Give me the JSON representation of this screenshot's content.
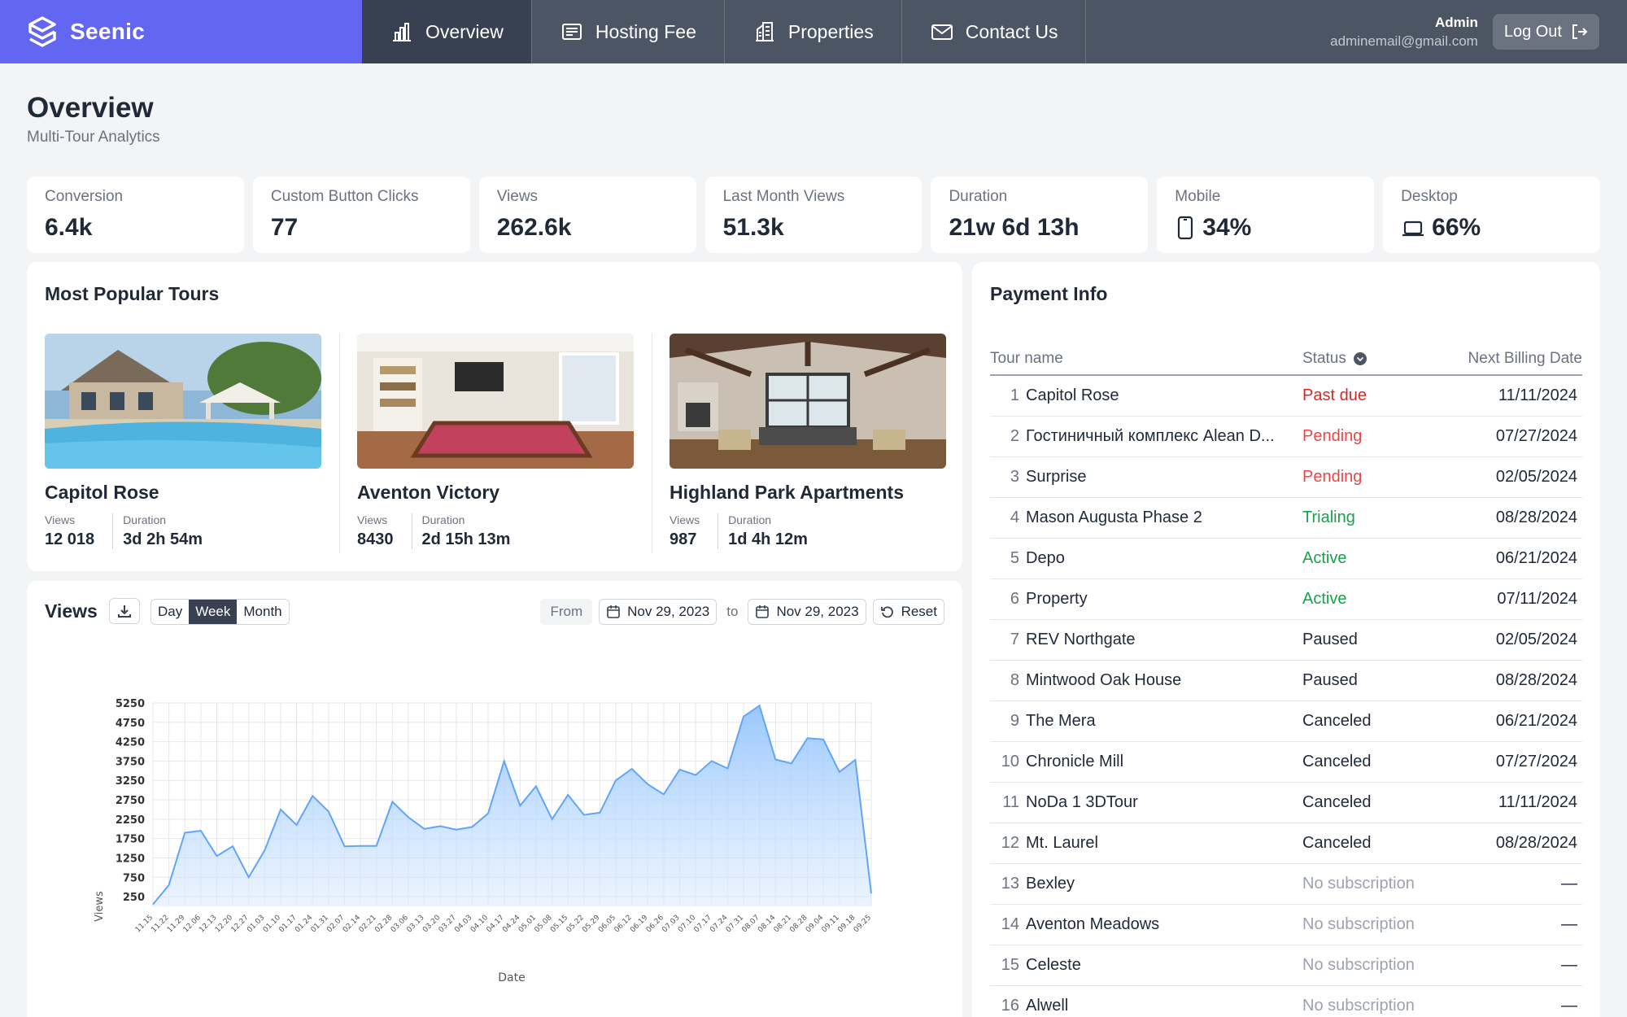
{
  "brand": {
    "name": "Seenic"
  },
  "nav": [
    {
      "label": "Overview",
      "icon": "chart-bar-icon"
    },
    {
      "label": "Hosting Fee",
      "icon": "receipt-icon"
    },
    {
      "label": "Properties",
      "icon": "building-icon"
    },
    {
      "label": "Contact Us",
      "icon": "mail-icon"
    }
  ],
  "user": {
    "role": "Admin",
    "email": "adminemail@gmail.com",
    "logout_label": "Log Out"
  },
  "header": {
    "title": "Overview",
    "subtitle": "Multi-Tour Analytics"
  },
  "stats": [
    {
      "label": "Conversion",
      "value": "6.4k"
    },
    {
      "label": "Custom Button Clicks",
      "value": "77"
    },
    {
      "label": "Views",
      "value": "262.6k"
    },
    {
      "label": "Last Month Views",
      "value": "51.3k"
    },
    {
      "label": "Duration",
      "value": "21w 6d 13h"
    },
    {
      "label": "Mobile",
      "value": "34%",
      "icon": "phone-icon"
    },
    {
      "label": "Desktop",
      "value": "66%",
      "icon": "laptop-icon"
    }
  ],
  "tours": {
    "title": "Most Popular Tours",
    "views_label": "Views",
    "duration_label": "Duration",
    "items": [
      {
        "name": "Capitol Rose",
        "views": "12 018",
        "duration": "3d 2h 54m"
      },
      {
        "name": "Aventon Victory",
        "views": "8430",
        "duration": "2d 15h 13m"
      },
      {
        "name": "Highland Park Apartments",
        "views": "987",
        "duration": "1d 4h 12m"
      }
    ]
  },
  "views_panel": {
    "title": "Views",
    "periods": [
      "Day",
      "Week",
      "Month"
    ],
    "active_period": "Week",
    "from_label": "From",
    "from_date": "Nov 29, 2023",
    "to_label": "to",
    "to_date": "Nov 29, 2023",
    "reset_label": "Reset"
  },
  "chart_data": {
    "type": "area",
    "xlabel": "Date",
    "ylabel": "Views",
    "yticks": [
      250,
      750,
      1250,
      1750,
      2250,
      2750,
      3250,
      3750,
      4250,
      4750,
      5250
    ],
    "ylim": [
      0,
      5250
    ],
    "grid": true,
    "x": [
      "11.15",
      "11.22",
      "11.29",
      "12.06",
      "12.13",
      "12.20",
      "12.27",
      "01.03",
      "01.10",
      "01.17",
      "01.24",
      "01.31",
      "02.07",
      "02.14",
      "02.21",
      "02.28",
      "03.06",
      "03.13",
      "03.20",
      "03.27",
      "04.03",
      "04.10",
      "04.17",
      "04.24",
      "05.01",
      "05.08",
      "05.15",
      "05.22",
      "05.29",
      "06.05",
      "06.12",
      "06.19",
      "06.26",
      "07.03",
      "07.10",
      "07.17",
      "07.24",
      "07.31",
      "08.07",
      "08.14",
      "08.21",
      "08.28",
      "09.04",
      "09.11",
      "09.18",
      "09.25"
    ],
    "values": [
      50,
      550,
      1900,
      1950,
      1300,
      1550,
      750,
      1450,
      2500,
      2100,
      2850,
      2450,
      1550,
      1560,
      1560,
      2700,
      2300,
      2000,
      2070,
      1980,
      2050,
      2400,
      3750,
      2600,
      3100,
      2250,
      2880,
      2360,
      2420,
      3250,
      3550,
      3150,
      2890,
      3530,
      3390,
      3750,
      3560,
      4900,
      5180,
      3790,
      3690,
      4340,
      4310,
      3470,
      3780,
      330
    ]
  },
  "payment": {
    "title": "Payment Info",
    "columns": {
      "name": "Tour name",
      "status": "Status",
      "date": "Next Billing Date"
    },
    "rows": [
      {
        "num": "1",
        "name": "Capitol Rose",
        "status": "Past due",
        "kind": "past",
        "date": "11/11/2024"
      },
      {
        "num": "2",
        "name": "Гостиничный комплекс Alean D...",
        "status": "Pending",
        "kind": "pending",
        "date": "07/27/2024"
      },
      {
        "num": "3",
        "name": "Surprise",
        "status": "Pending",
        "kind": "pending",
        "date": "02/05/2024"
      },
      {
        "num": "4",
        "name": "Mason Augusta Phase 2",
        "status": "Trialing",
        "kind": "trial",
        "date": "08/28/2024"
      },
      {
        "num": "5",
        "name": "Depo",
        "status": "Active",
        "kind": "active",
        "date": "06/21/2024"
      },
      {
        "num": "6",
        "name": "Property",
        "status": "Active",
        "kind": "active",
        "date": "07/11/2024"
      },
      {
        "num": "7",
        "name": "REV Northgate",
        "status": "Paused",
        "kind": "paused",
        "date": "02/05/2024"
      },
      {
        "num": "8",
        "name": "Mintwood Oak House",
        "status": "Paused",
        "kind": "paused",
        "date": "08/28/2024"
      },
      {
        "num": "9",
        "name": "The Mera",
        "status": "Canceled",
        "kind": "canceled",
        "date": "06/21/2024"
      },
      {
        "num": "10",
        "name": "Chronicle Mill",
        "status": "Canceled",
        "kind": "canceled",
        "date": "07/27/2024"
      },
      {
        "num": "11",
        "name": "NoDa 1 3DTour",
        "status": "Canceled",
        "kind": "canceled",
        "date": "11/11/2024"
      },
      {
        "num": "12",
        "name": "Mt. Laurel",
        "status": "Canceled",
        "kind": "canceled",
        "date": "08/28/2024"
      },
      {
        "num": "13",
        "name": "Bexley",
        "status": "No subscription",
        "kind": "none",
        "date": "—"
      },
      {
        "num": "14",
        "name": "Aventon Meadows",
        "status": "No subscription",
        "kind": "none",
        "date": "—"
      },
      {
        "num": "15",
        "name": "Celeste",
        "status": "No subscription",
        "kind": "none",
        "date": "—"
      },
      {
        "num": "16",
        "name": "Alwell",
        "status": "No subscription",
        "kind": "none",
        "date": "—"
      }
    ]
  },
  "colors": {
    "brand": "#6366f1",
    "nav": "#4b5563",
    "nav_active": "#374151",
    "chart_fill": "#93c5fd",
    "chart_line": "#60a5fa"
  }
}
